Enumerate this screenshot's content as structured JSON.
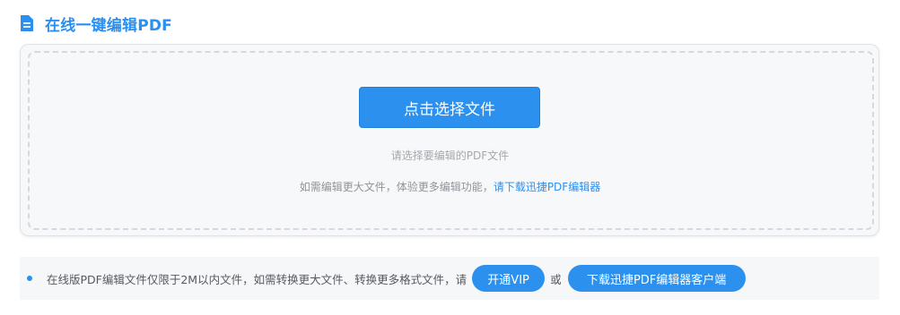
{
  "header": {
    "title": "在线一键编辑PDF",
    "icon": "document-icon"
  },
  "upload": {
    "button_label": "点击选择文件",
    "hint": "请选择要编辑的PDF文件",
    "more_prefix": "如需编辑更大文件，体验更多编辑功能，",
    "more_link": "请下载迅捷PDF编辑器"
  },
  "notice": {
    "text": "在线版PDF编辑文件仅限于2M以内文件，如需转换更大文件、转换更多格式文件，请",
    "vip_button": "开通VIP",
    "or_text": "或",
    "client_button": "下载迅捷PDF编辑器客户端"
  },
  "colors": {
    "accent": "#2c91ee",
    "panel_bg": "#f7f8fa"
  }
}
